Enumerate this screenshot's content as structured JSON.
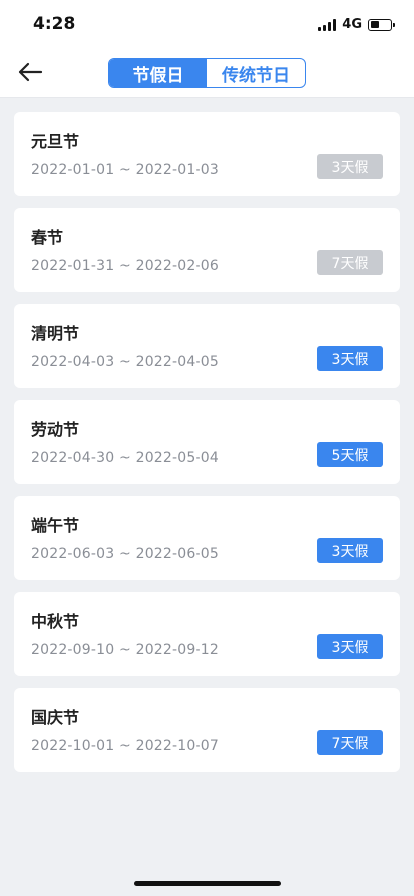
{
  "status_bar": {
    "time": "4:28",
    "network": "4G",
    "battery_level": 0.45
  },
  "nav": {
    "back_icon": "arrow-left-icon",
    "tabs": [
      {
        "label": "节假日",
        "active": true
      },
      {
        "label": "传统节日",
        "active": false
      }
    ]
  },
  "colors": {
    "accent": "#3a86ee",
    "past_badge": "#c8cbd0",
    "background": "#eef0f3"
  },
  "holidays": [
    {
      "name": "元旦节",
      "range": "2022-01-01 ~ 2022-01-03",
      "badge": "3天假",
      "status": "past"
    },
    {
      "name": "春节",
      "range": "2022-01-31 ~ 2022-02-06",
      "badge": "7天假",
      "status": "past"
    },
    {
      "name": "清明节",
      "range": "2022-04-03 ~ 2022-04-05",
      "badge": "3天假",
      "status": "upcoming"
    },
    {
      "name": "劳动节",
      "range": "2022-04-30 ~ 2022-05-04",
      "badge": "5天假",
      "status": "upcoming"
    },
    {
      "name": "端午节",
      "range": "2022-06-03 ~ 2022-06-05",
      "badge": "3天假",
      "status": "upcoming"
    },
    {
      "name": "中秋节",
      "range": "2022-09-10 ~ 2022-09-12",
      "badge": "3天假",
      "status": "upcoming"
    },
    {
      "name": "国庆节",
      "range": "2022-10-01 ~ 2022-10-07",
      "badge": "7天假",
      "status": "upcoming"
    }
  ]
}
